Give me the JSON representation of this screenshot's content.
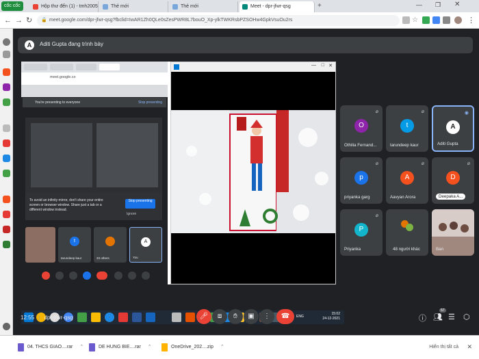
{
  "browser": {
    "brand": "cốc cốc",
    "tabs": [
      {
        "label": "Hộp thư đến (1) - tmh2005",
        "active": false
      },
      {
        "label": "Thẻ mới",
        "active": false
      },
      {
        "label": "Thẻ mới",
        "active": false
      },
      {
        "label": "Meet - dpr-jfwr-qsg",
        "active": true
      }
    ],
    "url": "meet.google.com/dpr-jfwr-qsg?fbclid=IwAR1Zh0QLe0sZesPWR8L7bouO_Xp-ylkTWKRsbPZSOHw4GpkVsuOu2rs"
  },
  "meet": {
    "presenting_banner": "Aditi Gupta đang trình bày",
    "presenting_avatar": "A",
    "shared_screen": {
      "inner_presenting_note": "You're presenting to everyone",
      "inner_stop_link": "Stop presenting",
      "inner_url": "meet.google.co",
      "warning_text": "To avoid an infinity mirror, don't share your entire screen or browser window. Share just a tab or a different window instead.",
      "stop_button": "Stop presenting",
      "ignore": "Ignore",
      "mini_tiles": [
        {
          "label": "tarundeep kaur",
          "letter": "t",
          "color": "#1a73e8"
        },
        {
          "label": "33 others",
          "letter": "",
          "color": "#e37400"
        },
        {
          "label": "You",
          "letter": "A",
          "color": "#fff"
        }
      ],
      "taskbar_time": "15:02",
      "taskbar_date": "24-12-2021",
      "taskbar_lang": "ENG"
    },
    "participants": [
      {
        "name": "Othilia Fernand...",
        "letter": "O",
        "color": "#8e24aa"
      },
      {
        "name": "tarundeep kaur",
        "letter": "t",
        "color": "#039be5"
      },
      {
        "name": "Aditi Gupta",
        "letter": "A",
        "color": "#ffffff"
      },
      {
        "name": "priyanka garg",
        "letter": "p",
        "color": "#1a73e8"
      },
      {
        "name": "Aavyan Arora",
        "letter": "A",
        "color": "#f4511e"
      },
      {
        "name": "Deepaka A...",
        "letter": "D",
        "color": "#f4511e"
      },
      {
        "name": "Priyanka",
        "letter": "P",
        "color": "#12b5cb"
      },
      {
        "name": "48 người khác",
        "letter": "",
        "color": "#e37400"
      },
      {
        "name": "Ban",
        "letter": "",
        "color": "#555"
      }
    ],
    "meeting_time": "12:55",
    "meeting_code": "dpr-jfwr-qsg",
    "participant_count": "57"
  },
  "downloads": {
    "items": [
      "04. THCS GIAO....rar",
      "DE HUNG BIE....rar",
      "OneDrive_202....zip"
    ],
    "show_all": "Hiển thị tất cả"
  }
}
